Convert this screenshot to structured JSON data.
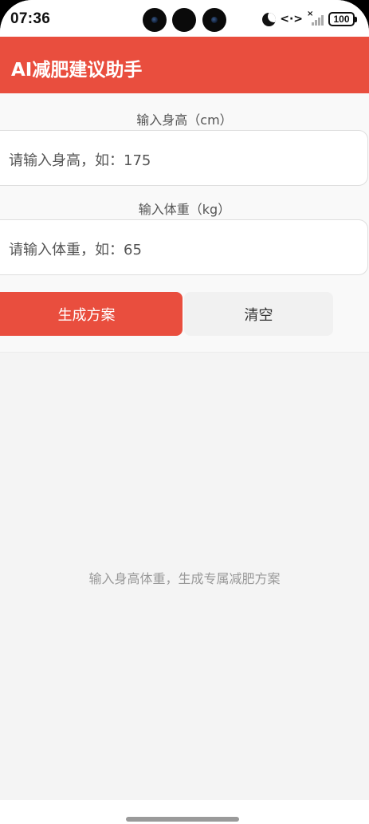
{
  "status_bar": {
    "time": "07:36",
    "battery": "100",
    "icons": [
      "moon-icon",
      "data-transfer-icon",
      "signal-icon",
      "battery-icon"
    ]
  },
  "header": {
    "title": "AI减肥建议助手",
    "color": "#E94E3E"
  },
  "form": {
    "height_label": "输入身高（cm）",
    "height_placeholder": "请输入身高，如：175",
    "weight_label": "输入体重（kg）",
    "weight_placeholder": "请输入体重，如：65"
  },
  "actions": {
    "generate_label": "生成方案",
    "clear_label": "清空"
  },
  "result": {
    "hint": "输入身高体重，生成专属减肥方案"
  }
}
